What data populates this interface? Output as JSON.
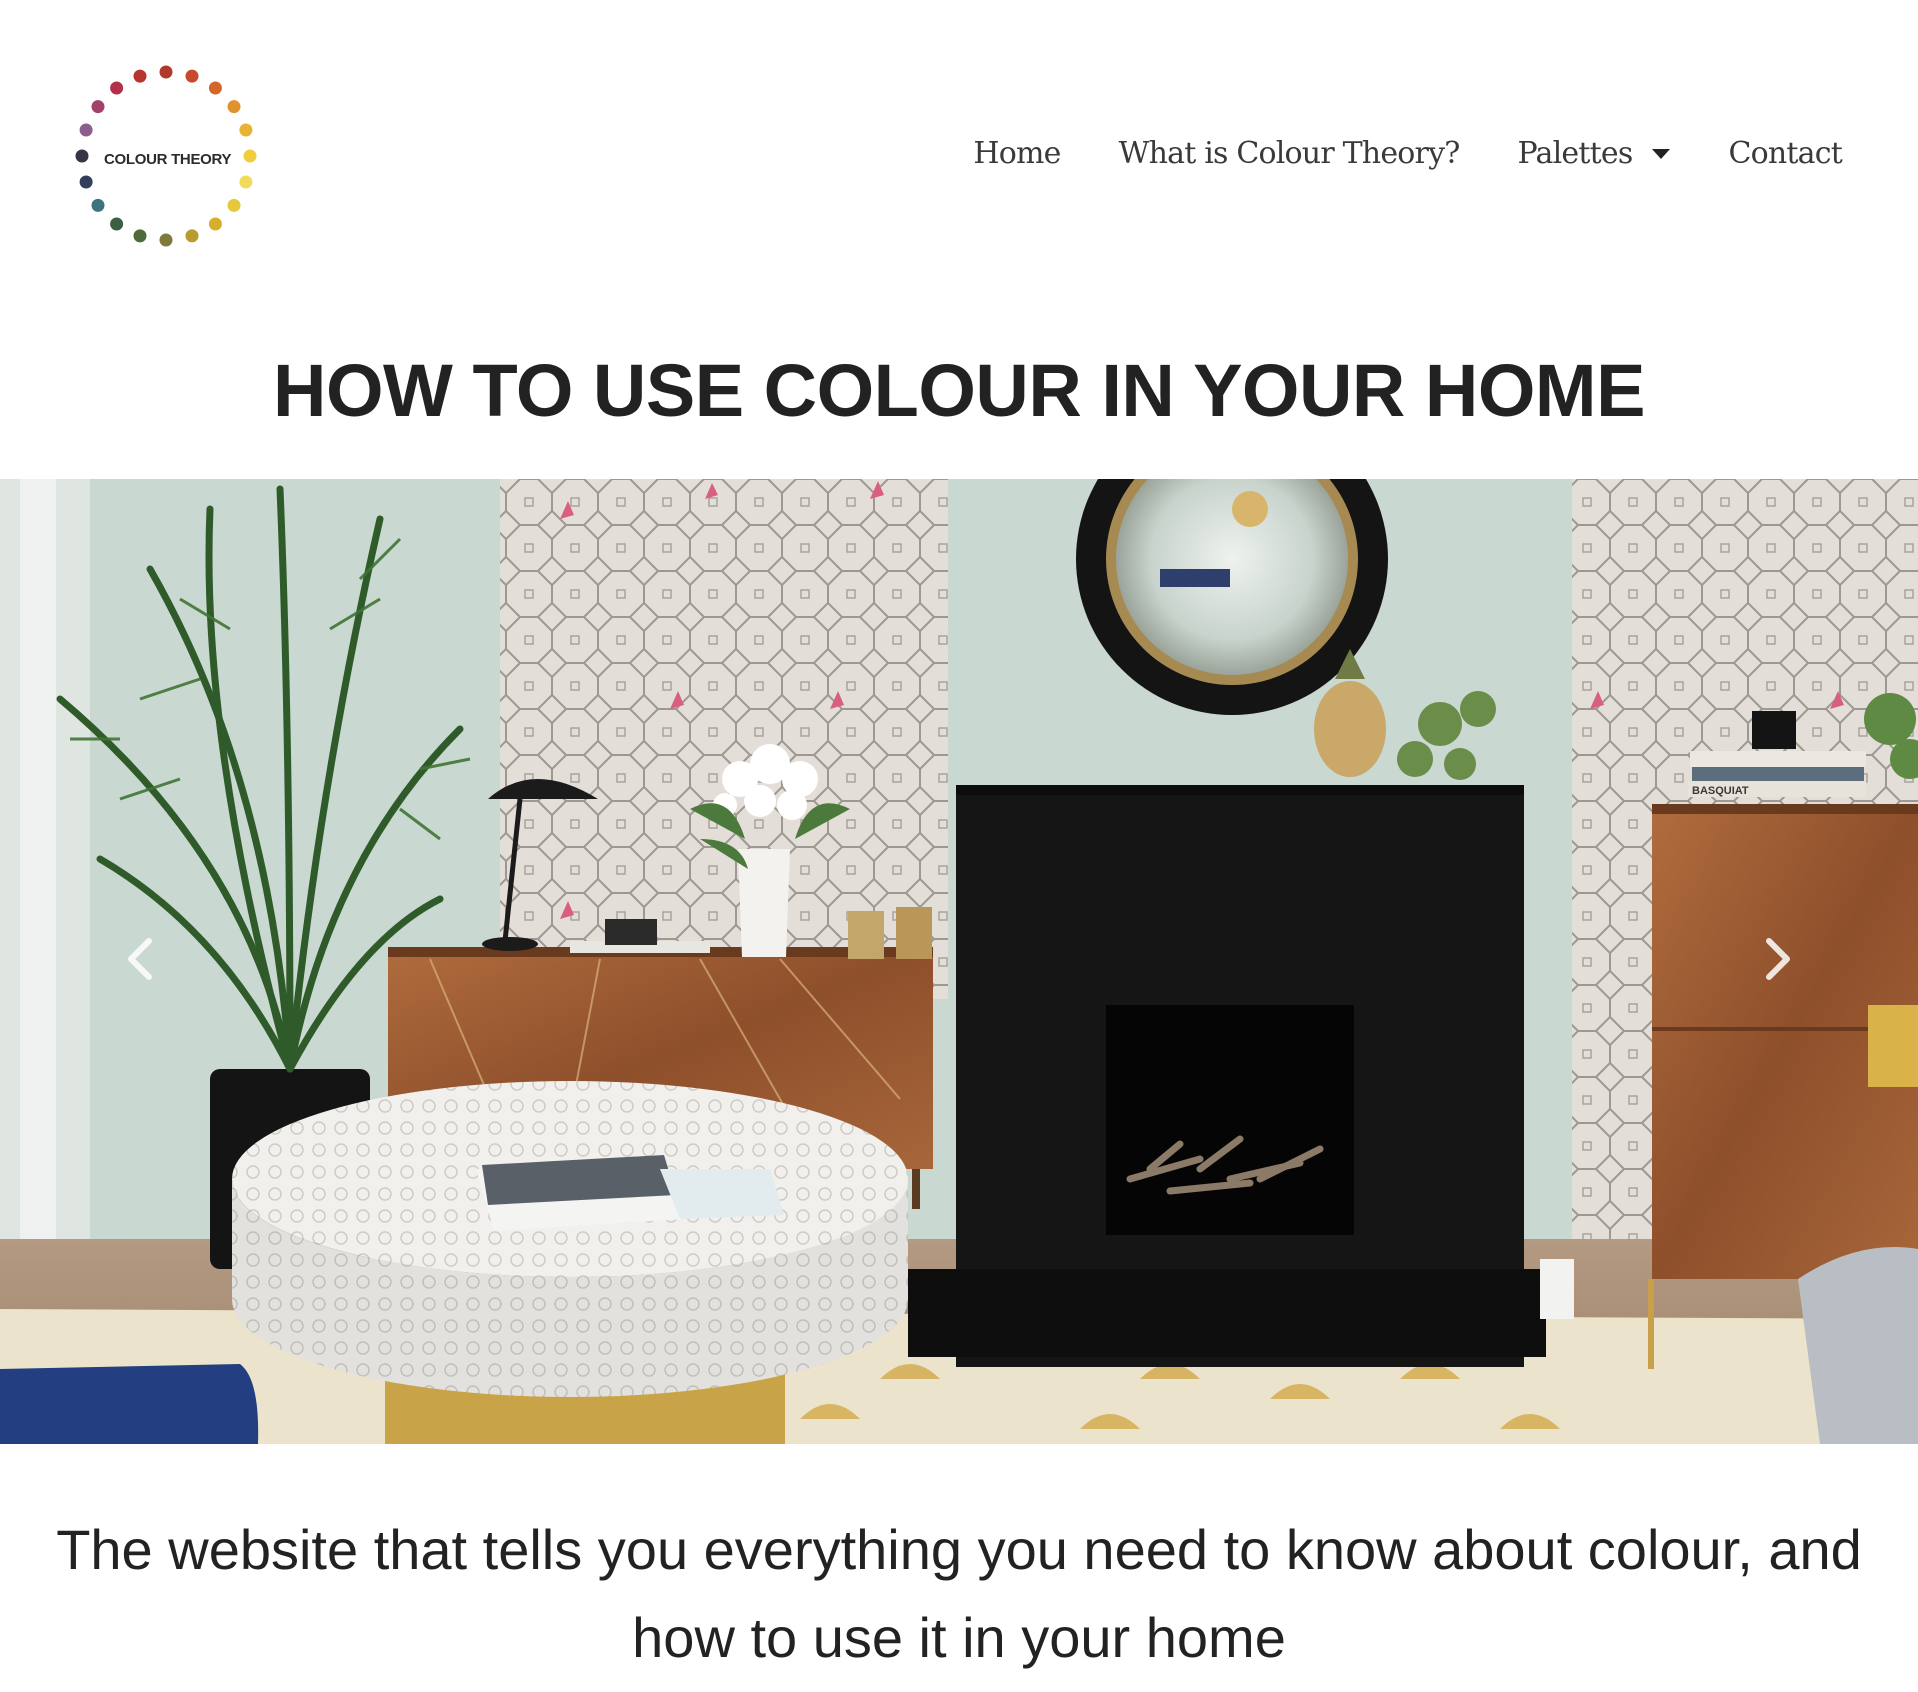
{
  "brand": {
    "logo_text": "COLOUR THEORY",
    "logo_icon": "colour-wheel-dots-icon",
    "dot_colors": [
      "#b0392e",
      "#c84a2c",
      "#d5662a",
      "#e0922f",
      "#e9b233",
      "#efcd3c",
      "#f1dc59",
      "#e7c83a",
      "#d7ae2b",
      "#b89c2e",
      "#7d7a3c",
      "#4f6a39",
      "#3c5f44",
      "#3c7380",
      "#2f3f5c",
      "#3a3344",
      "#8a5f8f",
      "#a2416a",
      "#b3304a",
      "#b8352e"
    ]
  },
  "nav": {
    "items": [
      {
        "label": "Home"
      },
      {
        "label": "What is Colour Theory?"
      },
      {
        "label": "Palettes",
        "has_dropdown": true
      },
      {
        "label": "Contact"
      }
    ]
  },
  "main": {
    "title": "HOW TO USE COLOUR IN YOUR HOME",
    "tagline_line1": "The website that tells you everything you need to know about colour, and",
    "tagline_line2": "how to use it in your home"
  },
  "carousel": {
    "prev_icon": "chevron-left-icon",
    "next_icon": "chevron-right-icon",
    "image_name": "living-room-photo",
    "book_spine_text": "BASQUIAT"
  },
  "colors": {
    "wall": "#c9d8d0",
    "fireplace": "#141414",
    "wood": "#9a5a33",
    "rug": "#e8dcc0"
  }
}
